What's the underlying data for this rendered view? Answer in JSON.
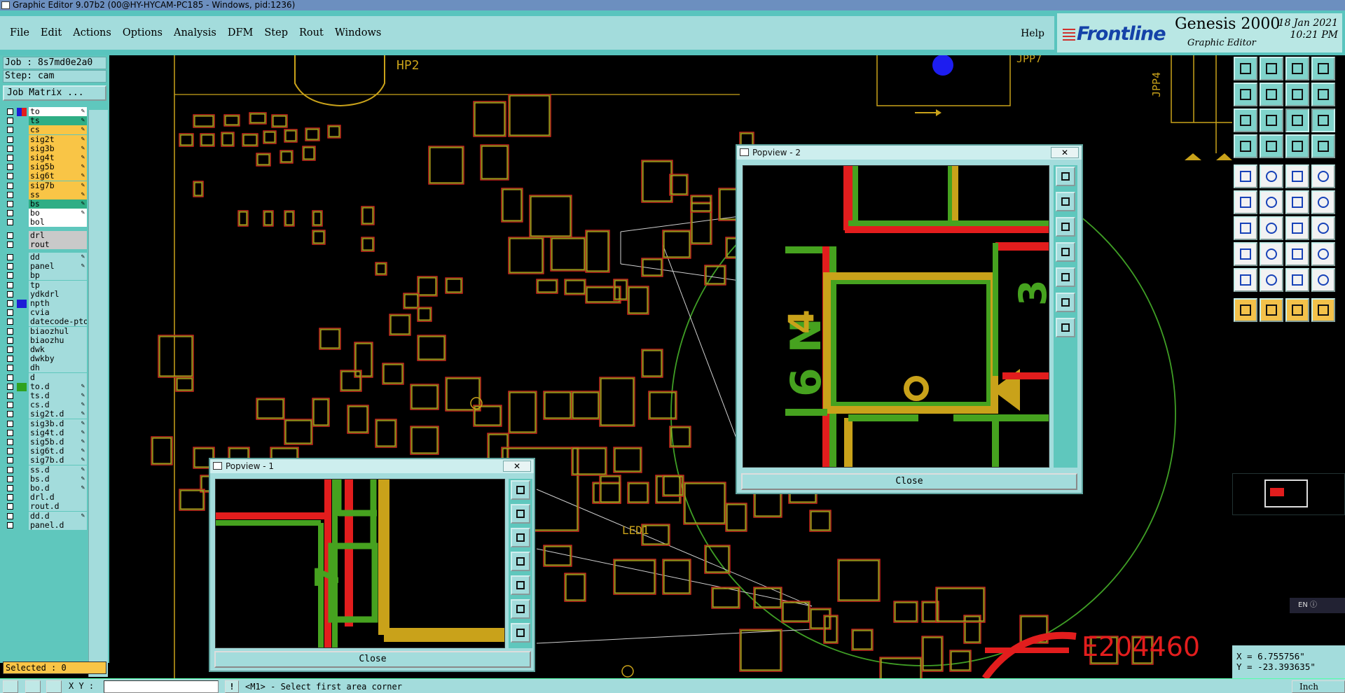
{
  "window": {
    "title": "Graphic Editor 9.07b2 (00@HY-HYCAM-PC185 - Windows, pid:1236)"
  },
  "menu": {
    "items": [
      "File",
      "Edit",
      "Actions",
      "Options",
      "Analysis",
      "DFM",
      "Step",
      "Rout",
      "Windows"
    ],
    "help": "Help"
  },
  "brand": {
    "logo": "Frontline",
    "product": "Genesis 2000",
    "subtitle": "Graphic Editor",
    "date": "18 Jan 2021",
    "time": "10:21 PM"
  },
  "job": {
    "job_line": "Job : 8s7md0e2a0",
    "step_line": "Step: cam",
    "job_matrix": "Job Matrix ..."
  },
  "layers": [
    {
      "name": "to",
      "bg": "#ffffff",
      "swatch": "#e21d1d",
      "swatch2": "#1d1dd6",
      "mark": "✎"
    },
    {
      "name": "ts",
      "bg": "#2fae85",
      "swatch": "",
      "mark": "✎"
    },
    {
      "name": "cs",
      "bg": "#f9c546",
      "swatch": "",
      "mark": "✎"
    },
    {
      "name": "sig2t",
      "bg": "#f9c546",
      "swatch": "",
      "mark": "✎"
    },
    {
      "name": "sig3b",
      "bg": "#f9c546",
      "swatch": "",
      "mark": "✎"
    },
    {
      "name": "sig4t",
      "bg": "#f9c546",
      "swatch": "",
      "mark": "✎"
    },
    {
      "name": "sig5b",
      "bg": "#f9c546",
      "swatch": "",
      "mark": "✎"
    },
    {
      "name": "sig6t",
      "bg": "#f9c546",
      "swatch": "",
      "mark": "✎"
    },
    {
      "name": "sig7b",
      "bg": "#f9c546",
      "swatch": "",
      "mark": "✎"
    },
    {
      "name": "ss",
      "bg": "#f9c546",
      "swatch": "",
      "mark": "✎"
    },
    {
      "name": "bs",
      "bg": "#2fae85",
      "swatch": "",
      "mark": "✎"
    },
    {
      "name": "bo",
      "bg": "#ffffff",
      "swatch": "",
      "mark": "✎"
    },
    {
      "name": "bol",
      "bg": "#ffffff",
      "swatch": "",
      "mark": ""
    },
    {
      "name": "drl",
      "bg": "#c9c9c9",
      "swatch": "",
      "mark": "",
      "gap": true
    },
    {
      "name": "rout",
      "bg": "#c9c9c9",
      "swatch": "",
      "mark": ""
    },
    {
      "name": "dd",
      "bg": "#a3dcdc",
      "swatch": "",
      "mark": "✎",
      "gap": true
    },
    {
      "name": "panel",
      "bg": "#a3dcdc",
      "swatch": "",
      "mark": "✎"
    },
    {
      "name": "bp",
      "bg": "#a3dcdc",
      "swatch": "",
      "mark": ""
    },
    {
      "name": "tp",
      "bg": "#a3dcdc",
      "swatch": "",
      "mark": ""
    },
    {
      "name": "ydkdrl",
      "bg": "#a3dcdc",
      "swatch": "",
      "mark": ""
    },
    {
      "name": "npth",
      "bg": "#a3dcdc",
      "swatch": "#1d1dd6",
      "mark": ""
    },
    {
      "name": "cvia",
      "bg": "#a3dcdc",
      "swatch": "",
      "mark": ""
    },
    {
      "name": "datecode-pto",
      "bg": "#a3dcdc",
      "swatch": "",
      "mark": ""
    },
    {
      "name": "biaozhul",
      "bg": "#a3dcdc",
      "swatch": "",
      "mark": ""
    },
    {
      "name": "biaozhu",
      "bg": "#a3dcdc",
      "swatch": "",
      "mark": ""
    },
    {
      "name": "dwk",
      "bg": "#a3dcdc",
      "swatch": "",
      "mark": ""
    },
    {
      "name": "dwkby",
      "bg": "#a3dcdc",
      "swatch": "",
      "mark": ""
    },
    {
      "name": "dh",
      "bg": "#a3dcdc",
      "swatch": "",
      "mark": ""
    },
    {
      "name": "d",
      "bg": "#a3dcdc",
      "swatch": "",
      "mark": ""
    },
    {
      "name": "to.d",
      "bg": "#a3dcdc",
      "swatch": "#2fa21f",
      "mark": "✎"
    },
    {
      "name": "ts.d",
      "bg": "#a3dcdc",
      "swatch": "",
      "mark": "✎"
    },
    {
      "name": "cs.d",
      "bg": "#a3dcdc",
      "swatch": "",
      "mark": "✎"
    },
    {
      "name": "sig2t.d",
      "bg": "#a3dcdc",
      "swatch": "",
      "mark": "✎"
    },
    {
      "name": "sig3b.d",
      "bg": "#a3dcdc",
      "swatch": "",
      "mark": "✎"
    },
    {
      "name": "sig4t.d",
      "bg": "#a3dcdc",
      "swatch": "",
      "mark": "✎"
    },
    {
      "name": "sig5b.d",
      "bg": "#a3dcdc",
      "swatch": "",
      "mark": "✎"
    },
    {
      "name": "sig6t.d",
      "bg": "#a3dcdc",
      "swatch": "",
      "mark": "✎"
    },
    {
      "name": "sig7b.d",
      "bg": "#a3dcdc",
      "swatch": "",
      "mark": "✎"
    },
    {
      "name": "ss.d",
      "bg": "#a3dcdc",
      "swatch": "",
      "mark": "✎"
    },
    {
      "name": "bs.d",
      "bg": "#a3dcdc",
      "swatch": "",
      "mark": "✎"
    },
    {
      "name": "bo.d",
      "bg": "#a3dcdc",
      "swatch": "",
      "mark": "✎"
    },
    {
      "name": "drl.d",
      "bg": "#a3dcdc",
      "swatch": "",
      "mark": ""
    },
    {
      "name": "rout.d",
      "bg": "#a3dcdc",
      "swatch": "",
      "mark": ""
    },
    {
      "name": "dd.d",
      "bg": "#a3dcdc",
      "swatch": "",
      "mark": "✎"
    },
    {
      "name": "panel.d",
      "bg": "#a3dcdc",
      "swatch": "",
      "mark": ""
    }
  ],
  "selected": "Selected : 0",
  "canvas_labels": {
    "hp2": "HP2",
    "jpp7": "JPP7",
    "jpp4": "JPP4",
    "led1": "LED1",
    "e_code": "E204460"
  },
  "popview1": {
    "title": "Popview - 1",
    "close": "Close"
  },
  "popview2": {
    "title": "Popview - 2",
    "close": "Close"
  },
  "coords": {
    "x": "X = 6.755756\"",
    "y": "Y = -23.393635\""
  },
  "status": {
    "xy_label": "X Y :",
    "xy_value": "",
    "message": "<M1> - Select first area corner",
    "units": "Inch"
  },
  "lang": "EN",
  "colors": {
    "accent": "#59c4be",
    "panel": "#a3dcdc",
    "trace_red": "#e21d1d",
    "trace_green": "#46a21f",
    "trace_gold": "#c9a21a"
  }
}
